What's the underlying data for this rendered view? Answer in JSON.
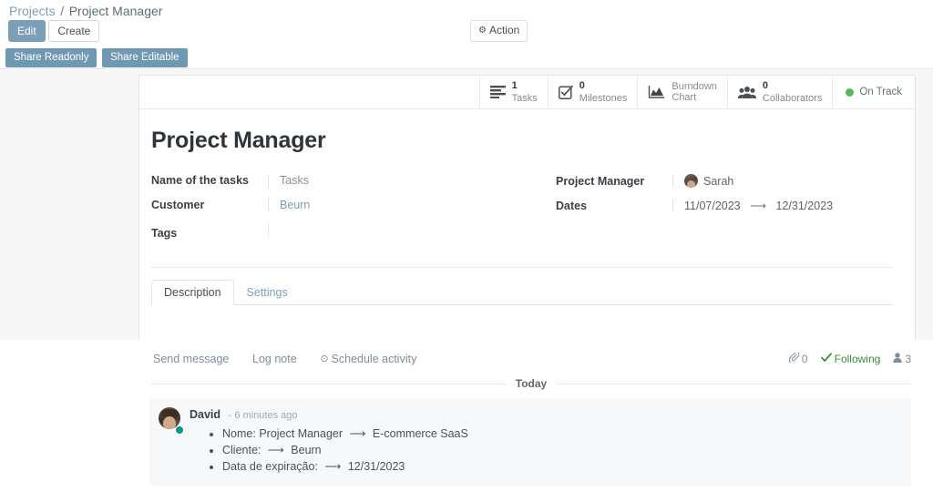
{
  "breadcrumb": {
    "root": "Projects",
    "separator": "/",
    "current": "Project Manager"
  },
  "control_panel": {
    "edit_label": "Edit",
    "create_label": "Create",
    "action_label": "Action",
    "action_icon": "gear-icon"
  },
  "share_bar": {
    "readonly_label": "Share Readonly",
    "editable_label": "Share Editable"
  },
  "stat_buttons": [
    {
      "icon": "list-bars-icon",
      "value": "1",
      "label": "Tasks"
    },
    {
      "icon": "check-square-icon",
      "value": "0",
      "label": "Milestones"
    },
    {
      "icon": "area-chart-icon",
      "value": "",
      "label": "Burndown\nChart",
      "label_line1": "Burndown",
      "label_line2": "Chart"
    },
    {
      "icon": "users-group-icon",
      "value": "0",
      "label": "Collaborators"
    }
  ],
  "status": {
    "label": "On Track",
    "color": "#5bb75b",
    "icon": "status-dot-icon"
  },
  "record": {
    "title": "Project Manager",
    "fields_left": [
      {
        "label": "Name of the tasks",
        "value": "Tasks",
        "style": "muted"
      },
      {
        "label": "Customer",
        "value": "Beurn",
        "style": "link"
      },
      {
        "label": "Tags",
        "value": "",
        "style": "muted"
      }
    ],
    "fields_right": [
      {
        "label": "Project Manager",
        "value": "Sarah",
        "style": "avatar"
      },
      {
        "label": "Dates",
        "value": "11/07/2023",
        "value_end": "12/31/2023",
        "arrow": "⟶",
        "style": "daterange"
      }
    ]
  },
  "notebook": {
    "tabs": [
      {
        "label": "Description",
        "active": true
      },
      {
        "label": "Settings",
        "active": false
      }
    ]
  },
  "chatter": {
    "actions": [
      {
        "label": "Send message",
        "icon": ""
      },
      {
        "label": "Log note",
        "icon": ""
      },
      {
        "label": "Schedule activity",
        "icon": "clock-icon"
      }
    ],
    "schedule_icon_glyph": "⊙",
    "attachments": {
      "icon": "paperclip-icon",
      "count": "0"
    },
    "following": {
      "icon": "check-icon",
      "label": "Following"
    },
    "followers": {
      "icon": "user-icon",
      "count": "3"
    },
    "date_separator": "Today",
    "messages": [
      {
        "author": "David",
        "time": "6 minutes ago",
        "time_prefix": "-",
        "avatar": "user-photo-avatar",
        "online": true,
        "tracked_values": [
          {
            "field": "Nome:",
            "old": "Project Manager",
            "arrow": "⟶",
            "new": "E-commerce SaaS"
          },
          {
            "field": "Cliente:",
            "old": "",
            "arrow": "⟶",
            "new": "Beurn"
          },
          {
            "field": "Data de expiração:",
            "old": "",
            "arrow": "⟶",
            "new": "12/31/2023"
          }
        ]
      }
    ]
  },
  "colors": {
    "primary_button": "#7c9eb6",
    "share_button": "#6f98b3",
    "link": "#7f9db9",
    "status_green": "#5bb75b",
    "following_green": "#3c8b3c",
    "online_dot": "#0d9488"
  }
}
